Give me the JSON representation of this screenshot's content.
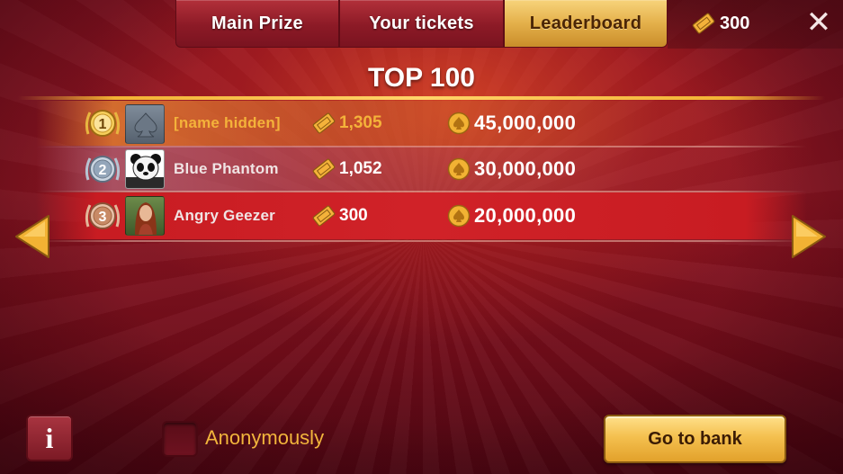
{
  "tabs": [
    {
      "label": "Main Prize",
      "active": false
    },
    {
      "label": "Your tickets",
      "active": false
    },
    {
      "label": "Leaderboard",
      "active": true
    }
  ],
  "header": {
    "ticket_balance": "300",
    "ticket_icon": "ticket-icon",
    "close_label": "✕"
  },
  "title": "TOP 100",
  "leaderboard": [
    {
      "rank": "1",
      "medal": "gold",
      "avatar": "spade-avatar",
      "name": "[name hidden]",
      "tickets": "1,305",
      "coins": "45,000,000"
    },
    {
      "rank": "2",
      "medal": "silver",
      "avatar": "panda-avatar",
      "name": "Blue Phantom",
      "tickets": "1,052",
      "coins": "30,000,000"
    },
    {
      "rank": "3",
      "medal": "bronze",
      "avatar": "woman-avatar",
      "name": "Angry Geezer",
      "tickets": "300",
      "coins": "20,000,000"
    }
  ],
  "footer": {
    "info_label": "i",
    "anonymous_label": "Anonymously",
    "anonymous_checked": false,
    "bank_button_label": "Go to bank"
  },
  "colors": {
    "gold": "#f4b23a",
    "background": "#8a1322",
    "highlight_row": "#d02228"
  }
}
